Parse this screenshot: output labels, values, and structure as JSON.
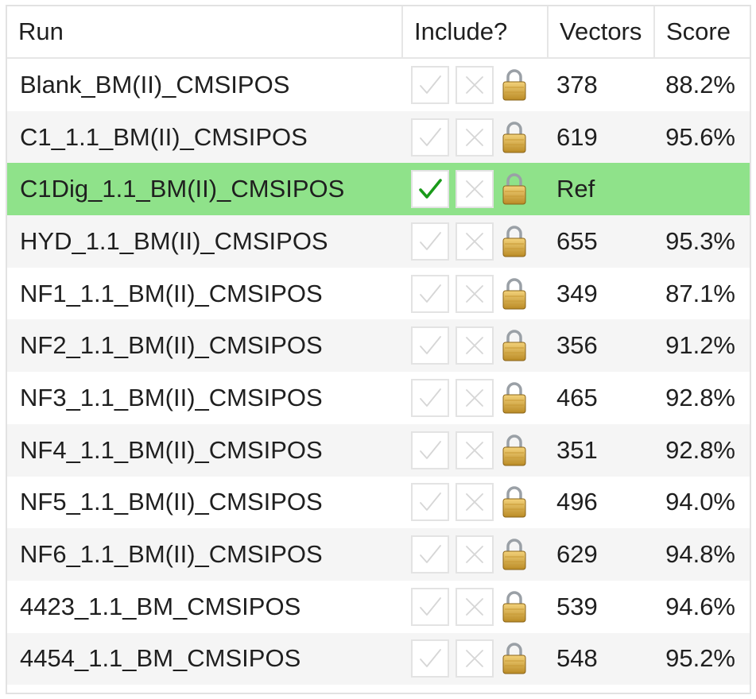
{
  "columns": {
    "run": "Run",
    "include": "Include?",
    "vectors": "Vectors",
    "score": "Score"
  },
  "icons": {
    "include": "checkmark-icon",
    "exclude": "x-icon",
    "lock": "padlock-icon"
  },
  "colors": {
    "selected_row": "#8fe28a",
    "check_active": "#1a9a1a",
    "check_inactive": "#d6d6d6"
  },
  "rows": [
    {
      "run": "Blank_BM(II)_CMSIPOS",
      "vectors": "378",
      "score": "88.2%",
      "included": false
    },
    {
      "run": "C1_1.1_BM(II)_CMSIPOS",
      "vectors": "619",
      "score": "95.6%",
      "included": false
    },
    {
      "run": "C1Dig_1.1_BM(II)_CMSIPOS",
      "vectors": "Ref",
      "score": "",
      "included": true,
      "selected": true
    },
    {
      "run": "HYD_1.1_BM(II)_CMSIPOS",
      "vectors": "655",
      "score": "95.3%",
      "included": false
    },
    {
      "run": "NF1_1.1_BM(II)_CMSIPOS",
      "vectors": "349",
      "score": "87.1%",
      "included": false
    },
    {
      "run": "NF2_1.1_BM(II)_CMSIPOS",
      "vectors": "356",
      "score": "91.2%",
      "included": false
    },
    {
      "run": "NF3_1.1_BM(II)_CMSIPOS",
      "vectors": "465",
      "score": "92.8%",
      "included": false
    },
    {
      "run": "NF4_1.1_BM(II)_CMSIPOS",
      "vectors": "351",
      "score": "92.8%",
      "included": false
    },
    {
      "run": "NF5_1.1_BM(II)_CMSIPOS",
      "vectors": "496",
      "score": "94.0%",
      "included": false
    },
    {
      "run": "NF6_1.1_BM(II)_CMSIPOS",
      "vectors": "629",
      "score": "94.8%",
      "included": false
    },
    {
      "run": "4423_1.1_BM_CMSIPOS",
      "vectors": "539",
      "score": "94.6%",
      "included": false
    },
    {
      "run": "4454_1.1_BM_CMSIPOS",
      "vectors": "548",
      "score": "95.2%",
      "included": false
    }
  ]
}
